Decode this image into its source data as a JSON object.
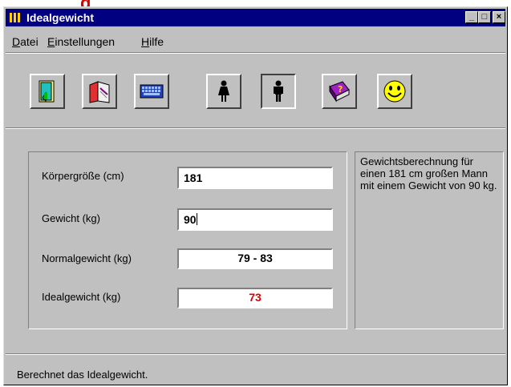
{
  "window": {
    "title": "Idealgewicht"
  },
  "red_fragment": "g",
  "window_buttons": {
    "minimize": "_",
    "maximize": "□",
    "close": "×"
  },
  "menu": [
    {
      "label": "Datei",
      "mnemonic": "D"
    },
    {
      "label": "Einstellungen",
      "mnemonic": "E"
    },
    {
      "label": "Hilfe",
      "mnemonic": "H"
    }
  ],
  "toolbar": {
    "buttons": [
      {
        "icon": "door-exit-icon"
      },
      {
        "icon": "book-print-icon"
      },
      {
        "icon": "keyboard-icon"
      },
      {
        "icon": "woman-icon"
      },
      {
        "icon": "man-icon",
        "pressed": true
      },
      {
        "icon": "help-book-icon"
      },
      {
        "icon": "smiley-icon"
      }
    ]
  },
  "form": {
    "height_label": "Körpergröße (cm)",
    "height_value": "181",
    "weight_label": "Gewicht (kg)",
    "weight_value": "90",
    "normal_label": "Normalgewicht (kg)",
    "normal_value": "79 - 83",
    "ideal_label": "Idealgewicht (kg)",
    "ideal_value": "73"
  },
  "info_text": "Gewichtsberechnung für einen 181 cm großen Mann mit einem Gewicht von 90 kg.",
  "status": "Berechnet das Idealgewicht.",
  "colors": {
    "titlebar": "#000080",
    "ideal_value": "#e00000",
    "face": "#c0c0c0"
  }
}
